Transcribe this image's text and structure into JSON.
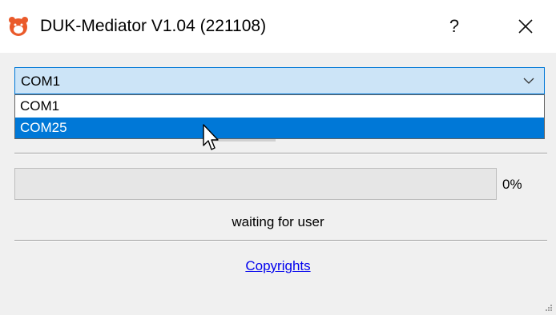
{
  "window": {
    "title": "DUK-Mediator V1.04 (221108)",
    "help_label": "?",
    "app_icon": "bear-head-icon",
    "close_icon": "close-icon"
  },
  "port_select": {
    "selected": "COM1",
    "options": [
      "COM1",
      "COM25"
    ],
    "highlighted": "COM25",
    "highlight_color": "#0078d7"
  },
  "progress": {
    "value_percent": 0,
    "label": "0%"
  },
  "status": {
    "text": "waiting for user"
  },
  "footer": {
    "link_label": "Copyrights",
    "link_color": "#0000ee"
  }
}
